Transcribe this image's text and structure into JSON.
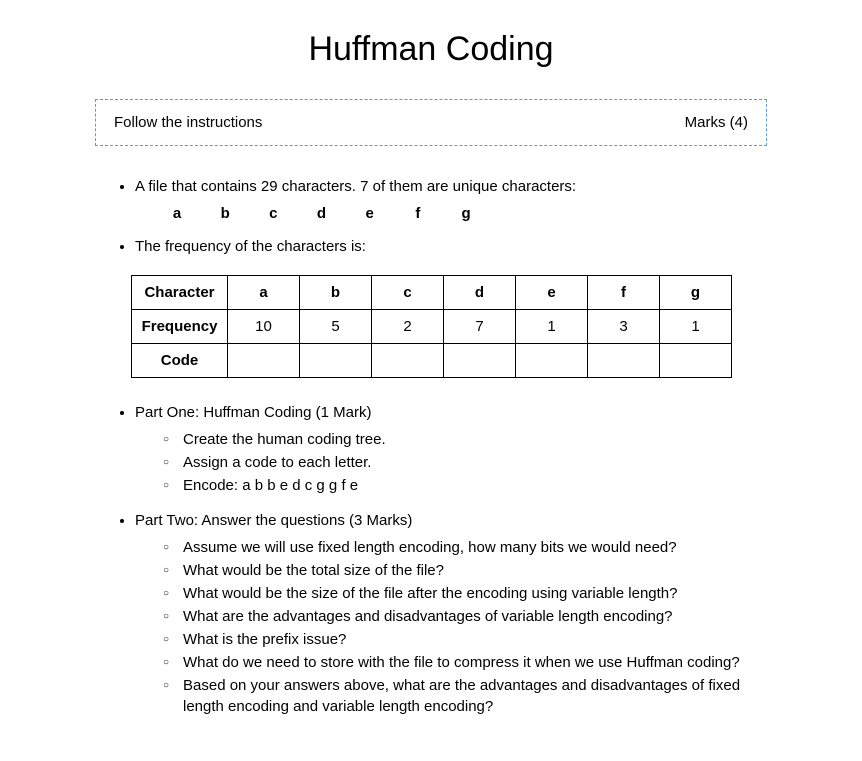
{
  "title": "Huffman Coding",
  "instruction": {
    "left": "Follow the instructions",
    "right": "Marks (4)"
  },
  "intro1": "A file that contains 29 characters. 7 of them are unique characters:",
  "chars": [
    "a",
    "b",
    "c",
    "d",
    "e",
    "f",
    "g"
  ],
  "intro2": "The frequency of the characters is:",
  "table": {
    "row1_label": "Character",
    "row2_label": "Frequency",
    "row3_label": "Code",
    "characters": [
      "a",
      "b",
      "c",
      "d",
      "e",
      "f",
      "g"
    ],
    "frequencies": [
      "10",
      "5",
      "2",
      "7",
      "1",
      "3",
      "1"
    ],
    "codes": [
      "",
      "",
      "",
      "",
      "",
      "",
      ""
    ]
  },
  "part1": {
    "heading": "Part One: Huffman Coding (1 Mark)",
    "items": [
      "Create the human coding tree.",
      "Assign a code to each letter.",
      "Encode: a b b e d c g g f e"
    ]
  },
  "part2": {
    "heading": "Part Two: Answer the questions (3 Marks)",
    "items": [
      "Assume we will use fixed length encoding, how many bits we would need?",
      "What would be the total size of the file?",
      "What would be the size of the file after the encoding using variable length?",
      "What are the advantages and disadvantages of variable length encoding?",
      "What is the prefix issue?",
      "What do we need to store with the file to compress it when we use Huffman coding?",
      "Based on your answers above, what are the advantages and disadvantages of fixed length encoding and variable length encoding?"
    ]
  },
  "chart_data": {
    "type": "table",
    "title": "Character frequency table for Huffman coding",
    "columns": [
      "Character",
      "Frequency",
      "Code"
    ],
    "rows": [
      {
        "Character": "a",
        "Frequency": 10,
        "Code": ""
      },
      {
        "Character": "b",
        "Frequency": 5,
        "Code": ""
      },
      {
        "Character": "c",
        "Frequency": 2,
        "Code": ""
      },
      {
        "Character": "d",
        "Frequency": 7,
        "Code": ""
      },
      {
        "Character": "e",
        "Frequency": 1,
        "Code": ""
      },
      {
        "Character": "f",
        "Frequency": 3,
        "Code": ""
      },
      {
        "Character": "g",
        "Frequency": 1,
        "Code": ""
      }
    ]
  }
}
